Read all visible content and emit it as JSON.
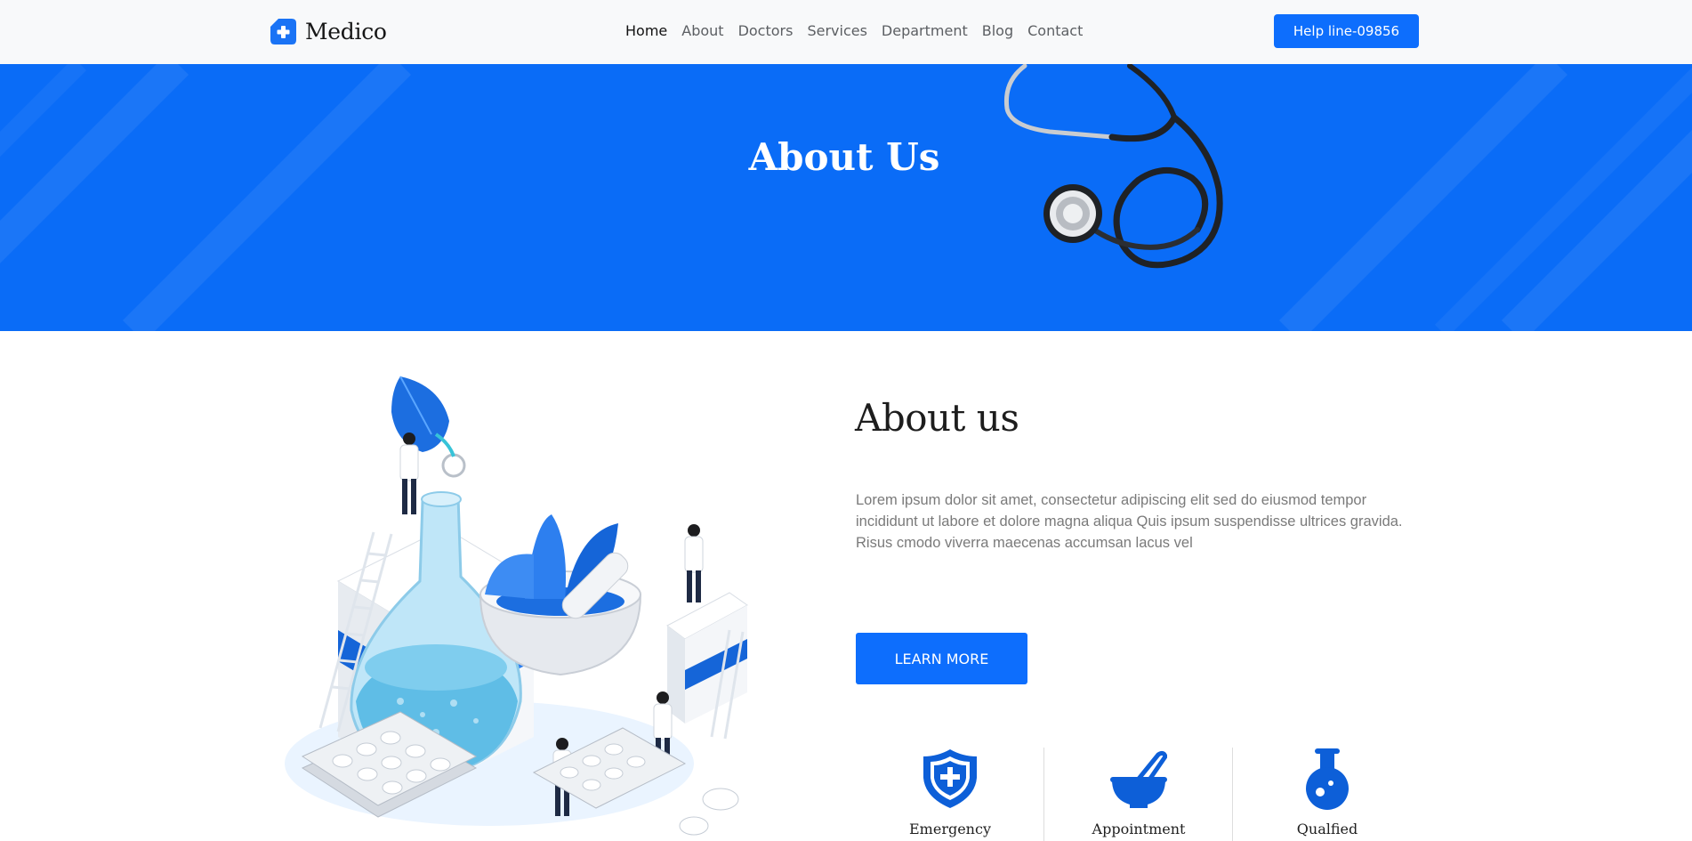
{
  "brand": {
    "name": "Medico",
    "icon": "medical-cross-icon"
  },
  "nav": {
    "items": [
      {
        "label": "Home",
        "active": true
      },
      {
        "label": "About",
        "active": false
      },
      {
        "label": "Doctors",
        "active": false
      },
      {
        "label": "Services",
        "active": false
      },
      {
        "label": "Department",
        "active": false
      },
      {
        "label": "Blog",
        "active": false
      },
      {
        "label": "Contact",
        "active": false
      }
    ],
    "helpline_label": "Help line-09856"
  },
  "hero": {
    "title": "About Us",
    "image": "stethoscope-image"
  },
  "about": {
    "image": "pharmacy-lab-illustration",
    "heading": "About us",
    "text": "Lorem ipsum dolor sit amet, consectetur adipiscing elit sed do eiusmod tempor incididunt ut labore et dolore magna aliqua Quis ipsum suspendisse ultrices gravida. Risus cmodo viverra maecenas accumsan lacus vel",
    "button_label": "LEARN MORE"
  },
  "features": [
    {
      "label": "Emergency",
      "icon": "shield-plus-icon"
    },
    {
      "label": "Appointment",
      "icon": "mortar-pestle-icon"
    },
    {
      "label": "Qualfied",
      "icon": "flask-icon"
    }
  ],
  "colors": {
    "primary": "#0d6efd",
    "hero_bg": "#0a6cf7",
    "navbar_bg": "#f8f9fa",
    "text_muted": "#7a7a7a"
  }
}
